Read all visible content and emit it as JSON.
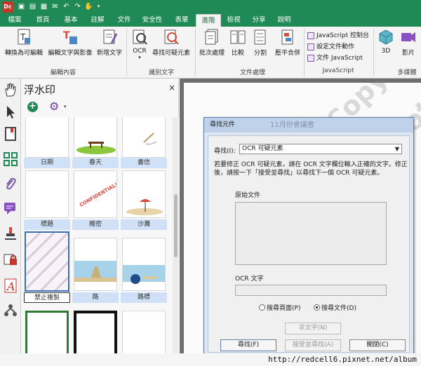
{
  "titlebar": {
    "app_logo": "Dc",
    "bg": "#1f8a56"
  },
  "tabs": [
    {
      "label": "檔案"
    },
    {
      "label": "首頁"
    },
    {
      "label": "基本"
    },
    {
      "label": "註解"
    },
    {
      "label": "文件"
    },
    {
      "label": "安全性"
    },
    {
      "label": "表單"
    },
    {
      "label": "進階",
      "active": true
    },
    {
      "label": "檢視"
    },
    {
      "label": "分享"
    },
    {
      "label": "說明"
    }
  ],
  "ribbon": {
    "buttons": [
      {
        "label": "轉換為可編輯",
        "icon": "convert-editable-icon"
      },
      {
        "label": "編輯文字與影像",
        "icon": "edit-text-image-icon"
      },
      {
        "label": "新增文字",
        "icon": "add-text-icon"
      },
      {
        "label": "OCR",
        "icon": "ocr-icon"
      },
      {
        "label": "尋找可疑元素",
        "icon": "find-suspect-icon"
      },
      {
        "label": "批次處理",
        "icon": "batch-process-icon"
      },
      {
        "label": "比較",
        "icon": "compare-icon"
      },
      {
        "label": "分割",
        "icon": "split-icon"
      },
      {
        "label": "壓平合併",
        "icon": "flatten-icon"
      },
      {
        "label": "3D",
        "icon": "3d-icon"
      },
      {
        "label": "影片",
        "icon": "video-icon"
      }
    ],
    "js_items": [
      "JavaScript 控制台",
      "設定文件動作",
      "文件 JavaScript"
    ],
    "groups": [
      "編輯內容",
      "識別文字",
      "文件處理",
      "JavaScript",
      "多媒體"
    ]
  },
  "panel": {
    "title": "浮水印",
    "close": "×",
    "add": "+",
    "gear": "⚙",
    "gear_caret": "▾",
    "thumbs": [
      {
        "label": "日期"
      },
      {
        "label": "春天"
      },
      {
        "label": "書信"
      },
      {
        "label": "標題"
      },
      {
        "label": "機密"
      },
      {
        "label": "沙灘"
      },
      {
        "label": "禁止複製"
      },
      {
        "label": "路"
      },
      {
        "label": "路標"
      }
    ],
    "confidential_text": "CONFIDENTIAL!"
  },
  "document": {
    "ghost_title": "11月份會議書",
    "watermark_text": "Do Not Copy"
  },
  "dialog": {
    "title": "尋找元件",
    "find_label": "尋找(I):",
    "find_value": "OCR 可疑元素",
    "instructions": "若要修正 OCR 可疑元素，請在 OCR 文字欄位輸入正確的文字。修正後，請按一下「接受並尋找」以尋找下一個 OCR 可疑元素。",
    "original_label": "原始文件",
    "ocr_label": "OCR 文字",
    "radio_page": "搜尋頁面(P)",
    "radio_doc": "搜尋文件(D)",
    "not_text_btn": "非文字(N)",
    "find_btn": "尋找(F)",
    "accept_btn": "接受並尋找(A)",
    "close_btn": "關閉(C)"
  },
  "footer": {
    "url": "http://redcell6.pixnet.net/album"
  }
}
